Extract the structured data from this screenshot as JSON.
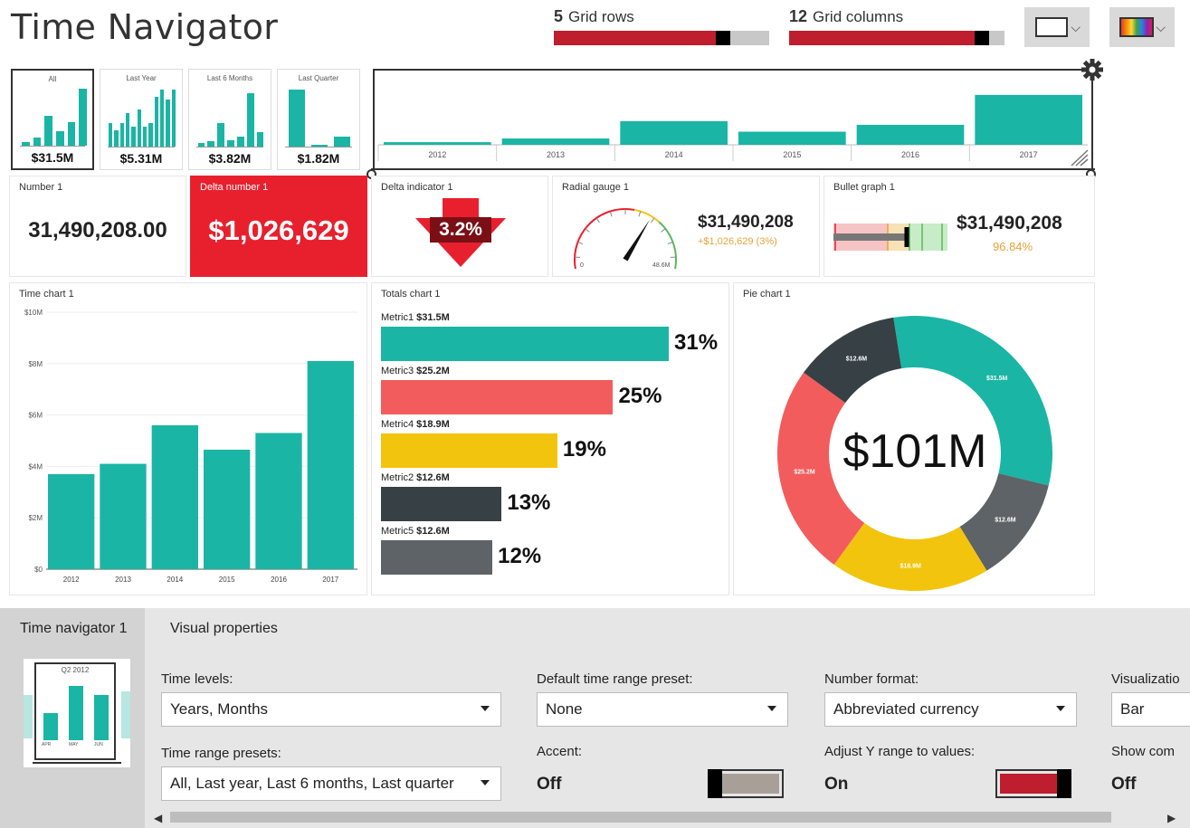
{
  "header": {
    "title": "Time Navigator",
    "grid_rows": {
      "value": "5",
      "label": "Grid rows",
      "fill": 0.82
    },
    "grid_columns": {
      "value": "12",
      "label": "Grid columns",
      "fill": 0.93
    }
  },
  "presets": [
    {
      "label": "All",
      "value": "$31.5M",
      "bars": [
        0.05,
        0.12,
        0.45,
        0.22,
        0.35,
        0.85
      ]
    },
    {
      "label": "Last Year",
      "value": "$5.31M",
      "bars": [
        0.35,
        0.25,
        0.35,
        0.5,
        0.3,
        0.55,
        0.3,
        0.35,
        0.75,
        0.85,
        0.7,
        0.85
      ]
    },
    {
      "label": "Last 6 Months",
      "value": "$3.82M",
      "bars": [
        0.05,
        0.08,
        0.35,
        0.1,
        0.15,
        0.8,
        0.22
      ]
    },
    {
      "label": "Last Quarter",
      "value": "$1.82M",
      "bars": [
        0.85,
        0.03,
        0.15
      ]
    }
  ],
  "navigator": {
    "years": [
      "2012",
      "2013",
      "2014",
      "2015",
      "2016",
      "2017"
    ],
    "values": [
      0.05,
      0.12,
      0.45,
      0.25,
      0.38,
      0.95
    ]
  },
  "tiles": {
    "number1": {
      "title": "Number 1",
      "value": "31,490,208.00"
    },
    "delta_number1": {
      "title": "Delta number 1",
      "value": "$1,026,629"
    },
    "delta_indicator1": {
      "title": "Delta indicator 1",
      "value": "3.2%"
    },
    "radial_gauge1": {
      "title": "Radial gauge 1",
      "value": "$31,490,208",
      "delta": "+$1,026,629 (3%)",
      "min": "0",
      "max": "48.6M",
      "fraction": 0.65
    },
    "bullet_graph1": {
      "title": "Bullet graph 1",
      "value": "$31,490,208",
      "pct": "96.84%",
      "fraction": 0.97
    }
  },
  "time_chart": {
    "title": "Time chart 1",
    "chart_data": {
      "type": "bar",
      "categories": [
        "2012",
        "2013",
        "2014",
        "2015",
        "2016",
        "2017"
      ],
      "values": [
        3.7,
        4.1,
        5.6,
        4.65,
        5.3,
        8.1
      ],
      "ylim": [
        0,
        10
      ],
      "yticks": [
        "$0",
        "$2M",
        "$4M",
        "$6M",
        "$8M",
        "$10M"
      ]
    }
  },
  "totals_chart": {
    "title": "Totals chart 1",
    "chart_data": {
      "type": "bar",
      "categories": [
        "Metric1",
        "Metric3",
        "Metric4",
        "Metric2",
        "Metric5"
      ],
      "amounts": [
        "$31.5M",
        "$25.2M",
        "$18.9M",
        "$12.6M",
        "$12.6M"
      ],
      "values": [
        31,
        25,
        19,
        13,
        12
      ],
      "labels": [
        "31%",
        "25%",
        "19%",
        "13%",
        "12%"
      ],
      "colors": [
        "#1ab5a5",
        "#f25c5c",
        "#f2c40e",
        "#374044",
        "#5d6366"
      ]
    }
  },
  "pie_chart": {
    "title": "Pie chart 1",
    "center": "$101M",
    "chart_data": {
      "type": "pie",
      "values": [
        31.5,
        12.6,
        18.9,
        25.2,
        12.6
      ],
      "labels": [
        "$31.5M",
        "$12.6M",
        "$18.9M",
        "$25.2M",
        "$12.6M"
      ],
      "colors": [
        "#1ab5a5",
        "#5d6366",
        "#f2c40e",
        "#f25c5c",
        "#374044"
      ]
    }
  },
  "bottom": {
    "tab": "Time navigator 1",
    "section": "Visual properties",
    "thumb_label": "Q2 2012",
    "thumb_ticks": [
      "APR",
      "MAY",
      "JUN"
    ],
    "time_levels": {
      "label": "Time levels:",
      "value": "Years, Months"
    },
    "time_range_presets": {
      "label": "Time range presets:",
      "value": "All, Last year, Last 6 months, Last quarter"
    },
    "default_preset": {
      "label": "Default time range preset:",
      "value": "None"
    },
    "accent": {
      "label": "Accent:",
      "value": "Off"
    },
    "number_format": {
      "label": "Number format:",
      "value": "Abbreviated currency"
    },
    "adjust_y": {
      "label": "Adjust Y range to values:",
      "value": "On"
    },
    "visualization": {
      "label": "Visualizatio",
      "value": "Bar"
    },
    "show_com": {
      "label": "Show com",
      "value": "Off"
    }
  },
  "colors": {
    "teal": "#1ab5a5",
    "red": "#be1e2d",
    "delta_red": "#e8202e"
  }
}
